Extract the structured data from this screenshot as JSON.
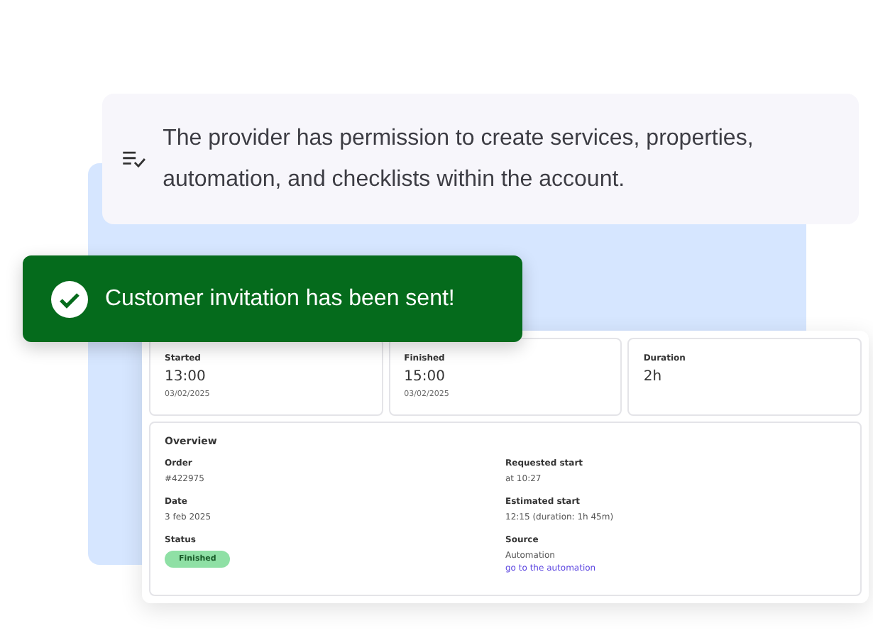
{
  "permission_note": {
    "text": "The provider has permission to create services, properties, automation, and checklists within the account."
  },
  "toast": {
    "message": "Customer invitation has been sent!"
  },
  "stats": [
    {
      "label": "Started",
      "value": "13:00",
      "date": "03/02/2025"
    },
    {
      "label": "Finished",
      "value": "15:00",
      "date": "03/02/2025"
    },
    {
      "label": "Duration",
      "value": "2h"
    }
  ],
  "overview": {
    "title": "Overview",
    "fields": [
      {
        "label": "Order",
        "kind": "text",
        "value": "#422975"
      },
      {
        "label": "Requested start",
        "kind": "text",
        "value": "at 10:27"
      },
      {
        "label": "Date",
        "kind": "text",
        "value": "3 feb 2025"
      },
      {
        "label": "Estimated start",
        "kind": "text",
        "value": "12:15 (duration: 1h 45m)"
      },
      {
        "label": "Status",
        "kind": "badge",
        "value": "Finished"
      },
      {
        "label": "Source",
        "kind": "link",
        "value": "Automation",
        "link": "go to the automation"
      }
    ]
  }
}
